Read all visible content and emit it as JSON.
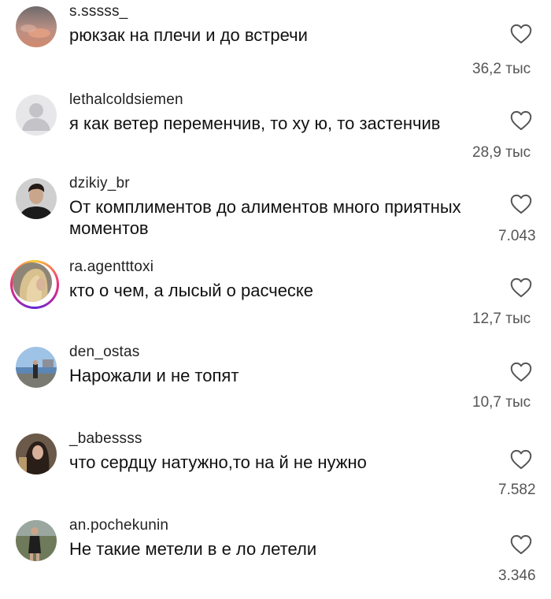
{
  "comments": [
    {
      "username": "s.sssss_",
      "text": "рюкзак на плечи и до встречи",
      "likes": "36,2 тыс",
      "avatar": "sunset-avatar"
    },
    {
      "username": "lethalcoldsiemen",
      "text": "я как ветер переменчив, то ху ю, то застенчив",
      "likes": "28,9 тыс",
      "avatar": "default-avatar"
    },
    {
      "username": "dzikiy_br",
      "text": "От комплиментов до алиментов много приятных моментов",
      "likes": "7.043",
      "avatar": "man-portrait-avatar"
    },
    {
      "username": "ra.agentttoxi",
      "text": "кто о чем, а лысый о расческе",
      "likes": "12,7 тыс",
      "avatar": "blonde-hair-avatar"
    },
    {
      "username": "den_ostas",
      "text": "Нарожали и не топят",
      "likes": "10,7 тыс",
      "avatar": "seaside-avatar"
    },
    {
      "username": "_babessss",
      "text": "что сердцу натужно,то на й не нужно",
      "likes": "7.582",
      "avatar": "woman-portrait-avatar"
    },
    {
      "username": "an.pochekunin",
      "text": "Не такие метели в е ло летели",
      "likes": "3.346",
      "avatar": "outdoor-figure-avatar"
    }
  ],
  "icons": {
    "like": "heart-outline-icon"
  },
  "colors": {
    "text": "#111111",
    "username": "#222222",
    "likes": "#555555",
    "story_ring": "#ee2a7b"
  }
}
